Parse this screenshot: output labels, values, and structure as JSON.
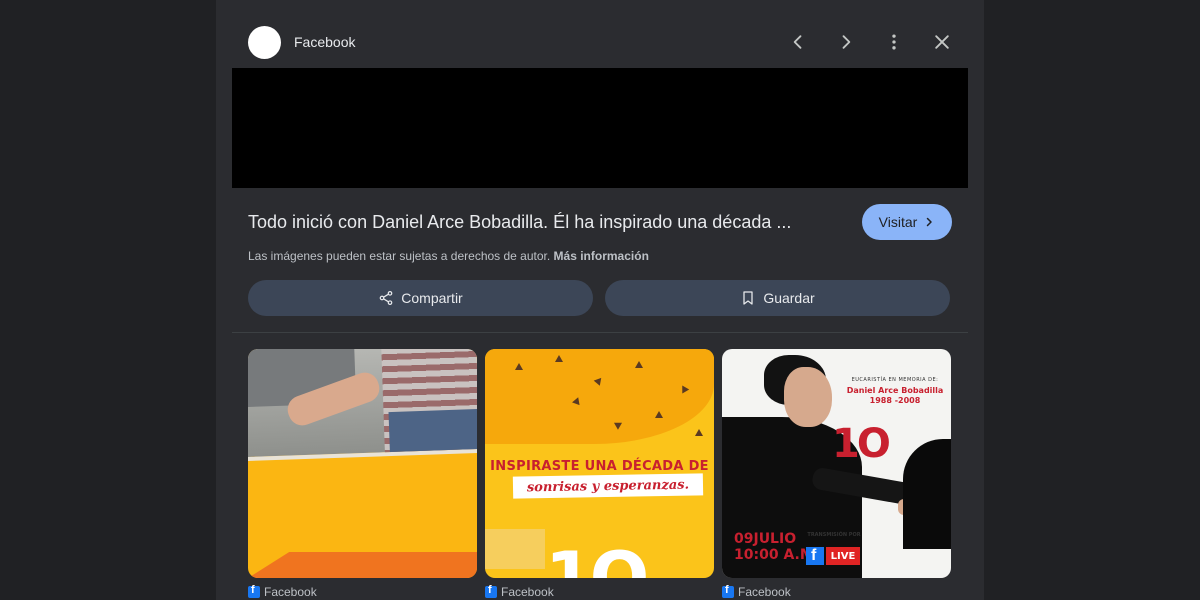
{
  "header": {
    "source_name": "Facebook",
    "icons": [
      "chevron-left-icon",
      "chevron-right-icon",
      "more-vert-icon",
      "close-icon"
    ]
  },
  "result": {
    "title": "Todo inició con Daniel Arce Bobadilla. Él ha inspirado una década ...",
    "visit_label": "Visitar",
    "copyright_text": "Las imágenes pueden estar sujetas a derechos de autor.",
    "copyright_more": "Más información"
  },
  "actions": {
    "share_label": "Compartir",
    "save_label": "Guardar"
  },
  "related": [
    {
      "source": "Facebook"
    },
    {
      "source": "Facebook",
      "headline": "INSPIRASTE UNA DÉCADA DE",
      "subline": "sonrisas y esperanzas."
    },
    {
      "source": "Facebook",
      "memorial": "EUCARISTÍA EN MEMORIA DE:",
      "person": "Daniel Arce Bobadilla",
      "years": "1988 -2008",
      "date": "09JULIO",
      "time": "10:00 A.M.",
      "transmission": "TRANSMISIÓN POR",
      "live": "LIVE"
    }
  ],
  "colors": {
    "background": "#202124",
    "panel": "#2b2c30",
    "accent": "#8ab4f8",
    "pill": "#3c4657"
  }
}
